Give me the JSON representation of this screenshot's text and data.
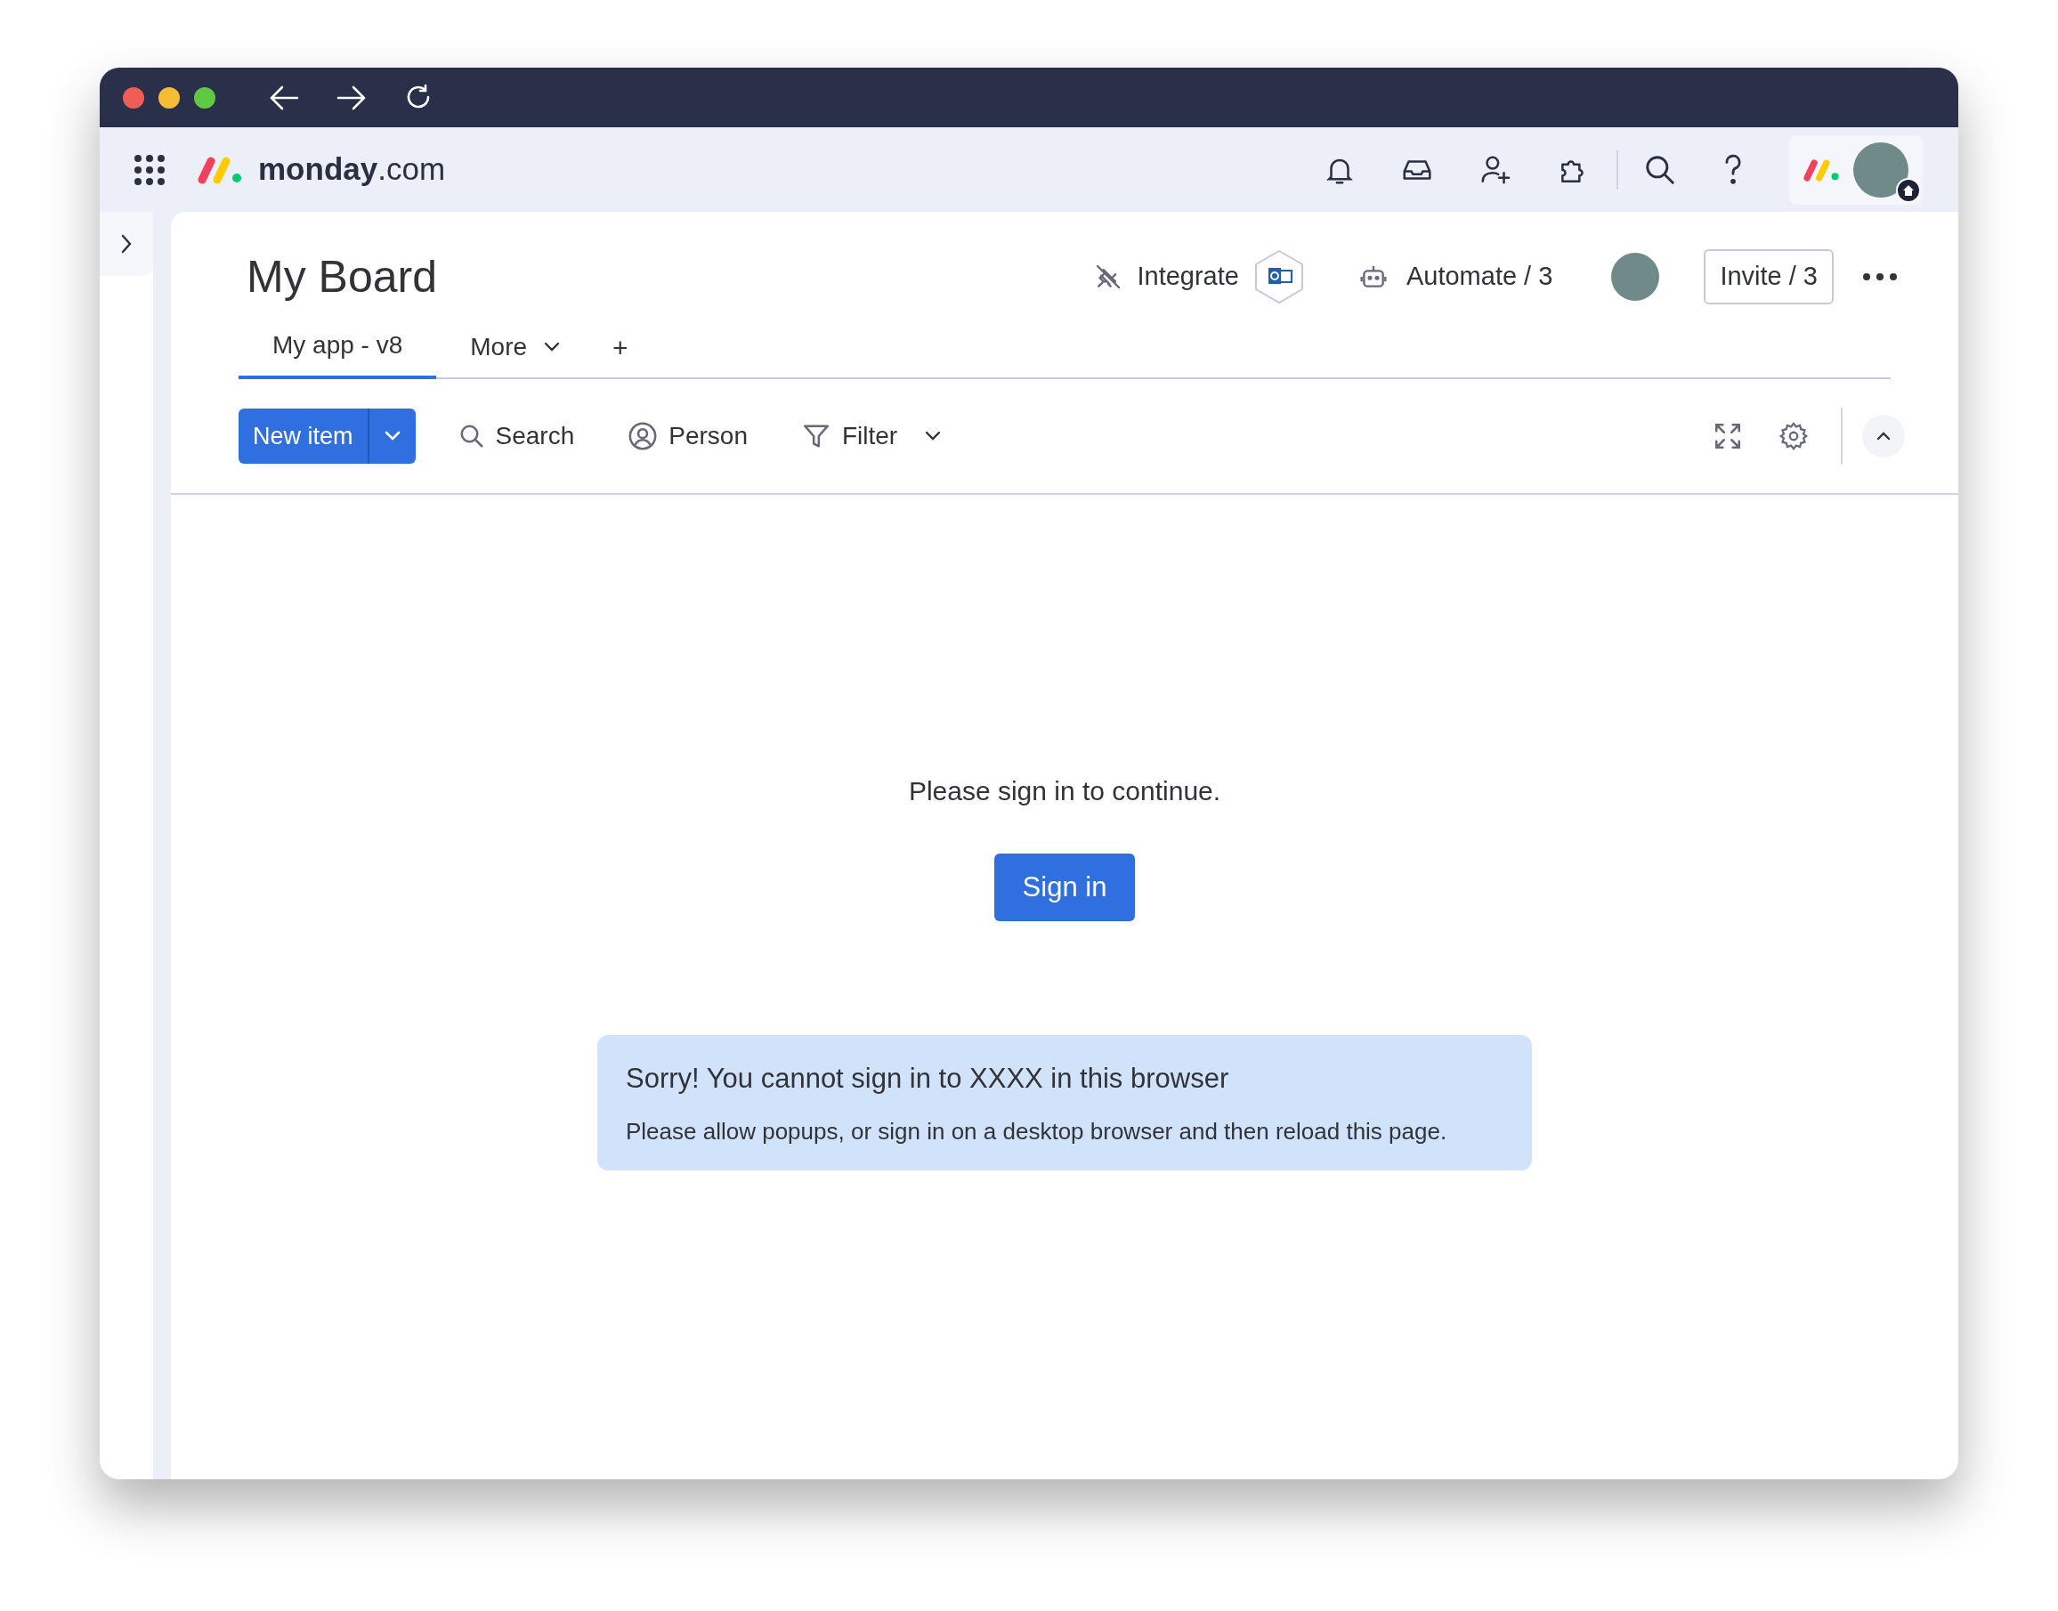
{
  "top_bar": {
    "logo_text": "**monday**.com"
  },
  "board": {
    "title": "My Board",
    "actions": [
      {
        "kind": "integrate",
        "label": "Integrate"
      },
      {
        "kind": "automate",
        "label": "Automate / 3"
      },
      {
        "kind": "invite",
        "label": "Invite / 3"
      }
    ]
  },
  "tabs": [
    {
      "label": "My app - v8",
      "selected": true
    },
    {
      "label": "More",
      "selected": false
    }
  ],
  "add_tab": "+",
  "toolbar": {
    "new_item": "New item",
    "tools": [
      {
        "kind": "search",
        "label": "Search"
      },
      {
        "kind": "person",
        "label": "Person"
      },
      {
        "kind": "filter",
        "label": "Filter"
      }
    ]
  },
  "content": {
    "message": "Please sign in to continue.",
    "button": "Sign in",
    "alert": {
      "title": "Sorry! You cannot sign in to XXXX in this browser",
      "body": "Please allow popups, or sign in on a desktop browser and then reload this page."
    }
  }
}
